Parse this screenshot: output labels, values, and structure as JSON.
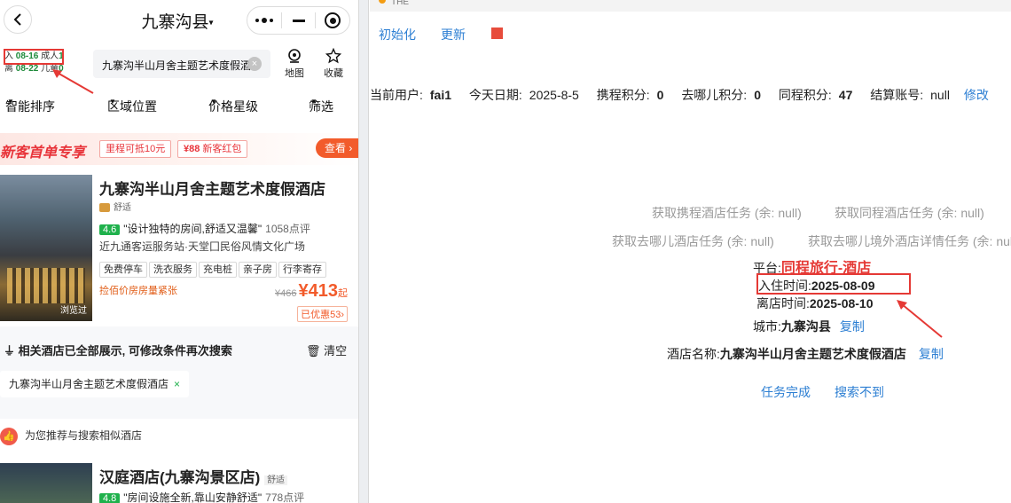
{
  "mobile": {
    "title": "九寨沟县",
    "dates": {
      "checkin_label": "入",
      "checkin_date": "08-16",
      "checkout_label": "离",
      "checkout_date": "08-22",
      "adult_label": "成人",
      "adult_count": "1",
      "child_label": "儿童",
      "child_count": "0"
    },
    "search_text": "九寨沟半山月舍主题艺术度假酒店",
    "map_label": "地图",
    "fav_label": "收藏",
    "filters": [
      "智能排序",
      "区域位置",
      "价格星级",
      "筛选"
    ],
    "promo": {
      "title": "新客首单专享",
      "tag1": "里程可抵10元",
      "tag2_price": "¥88",
      "tag2_text": "新客红包",
      "button": "查看"
    },
    "hotel1": {
      "name": "九寨沟半山月舍主题艺术度假酒店",
      "level": "舒适",
      "score": "4.6",
      "quote": "\"设计独特的房间,舒适又温馨\"",
      "reviews": "1058点评",
      "location": "近九通客运服务站·天堂囗民俗风情文化广场",
      "chips": [
        "免费停车",
        "洗衣服务",
        "充电桩",
        "亲子房",
        "行李寄存"
      ],
      "warning": "捡佰价房房量紧张",
      "original_price": "¥466",
      "price": "¥413",
      "price_suffix": "起",
      "discount": "已优惠53",
      "seen_badge": "浏览过"
    },
    "notice": {
      "text": "相关酒店已全部展示, 可修改条件再次搜索",
      "clear": "清空",
      "keyword": "九寨沟半山月舍主题艺术度假酒店"
    },
    "recommend": "为您推荐与搜索相似酒店",
    "hotel2": {
      "name": "汉庭酒店(九寨沟景区店)",
      "level": "舒适",
      "score": "4.8",
      "quote": "\"房间设施全新,靠山安静舒适\"",
      "reviews": "778点评"
    }
  },
  "panel": {
    "header_title": "THE",
    "init_label": "初始化",
    "update_label": "更新",
    "info": {
      "user_label": "当前用户:",
      "user": "fai1",
      "date_label": "今天日期:",
      "date": "2025-8-5",
      "ctrip_label": "携程积分:",
      "ctrip": "0",
      "qunar_label": "去哪儿积分:",
      "qunar": "0",
      "tongcheng_label": "同程积分:",
      "tongcheng": "47",
      "account_label": "结算账号:",
      "account": "null",
      "edit": "修改"
    },
    "tasks": {
      "ctrip": "获取携程酒店任务 (余: null)",
      "tongcheng": "获取同程酒店任务 (余: null)",
      "qunar": "获取去哪儿酒店任务 (余: null)",
      "qunar_overseas": "获取去哪儿境外酒店详情任务 (余: null)"
    },
    "platform_label": "平台:",
    "platform": "同程旅行-酒店",
    "checkin_label": "入住时间:",
    "checkin": "2025-08-09",
    "checkout_label": "离店时间:",
    "checkout": "2025-08-10",
    "city_label": "城市:",
    "city": "九寨沟县",
    "copy": "复制",
    "hotel_label": "酒店名称:",
    "hotel": "九寨沟半山月舍主题艺术度假酒店",
    "done": "任务完成",
    "notfound": "搜索不到"
  },
  "colors": {
    "link": "#2d7fd3",
    "accent_red": "#e53935",
    "green": "#1fb14c",
    "price": "#f25b2b"
  }
}
